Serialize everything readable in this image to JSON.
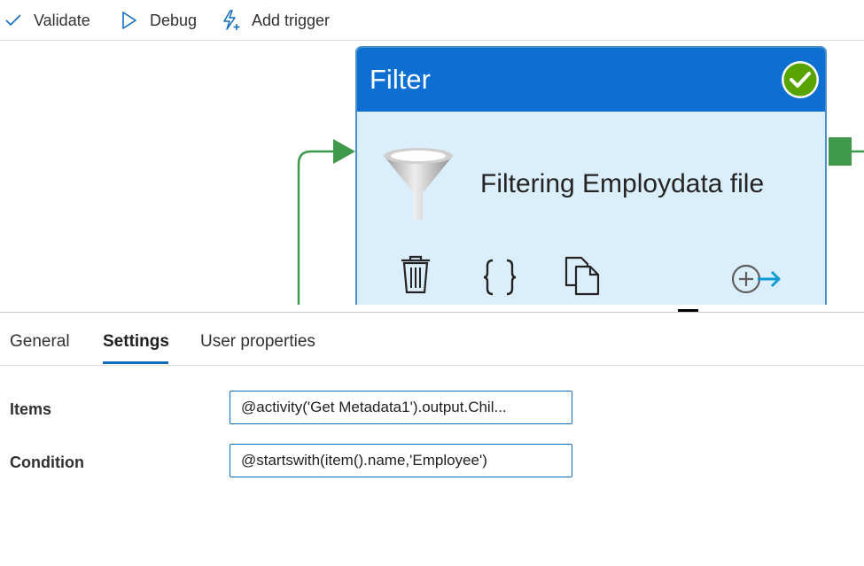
{
  "toolbar": {
    "validate_label": "Validate",
    "debug_label": "Debug",
    "add_trigger_label": "Add trigger"
  },
  "activity": {
    "type_title": "Filter",
    "name": "Filtering Employdata file",
    "status": "succeeded"
  },
  "tabs": [
    {
      "label": "General"
    },
    {
      "label": "Settings"
    },
    {
      "label": "User properties"
    }
  ],
  "settings": {
    "items_label": "Items",
    "items_value": "@activity('Get Metadata1').output.Chil...",
    "condition_label": "Condition",
    "condition_value": "@startswith(item().name,'Employee')"
  },
  "colors": {
    "header_blue": "#0c6fd1",
    "body_blue": "#dbeefc",
    "success_green": "#57a300",
    "connector_green": "#3e9a4a",
    "accent_blue": "#0f6cbd"
  }
}
